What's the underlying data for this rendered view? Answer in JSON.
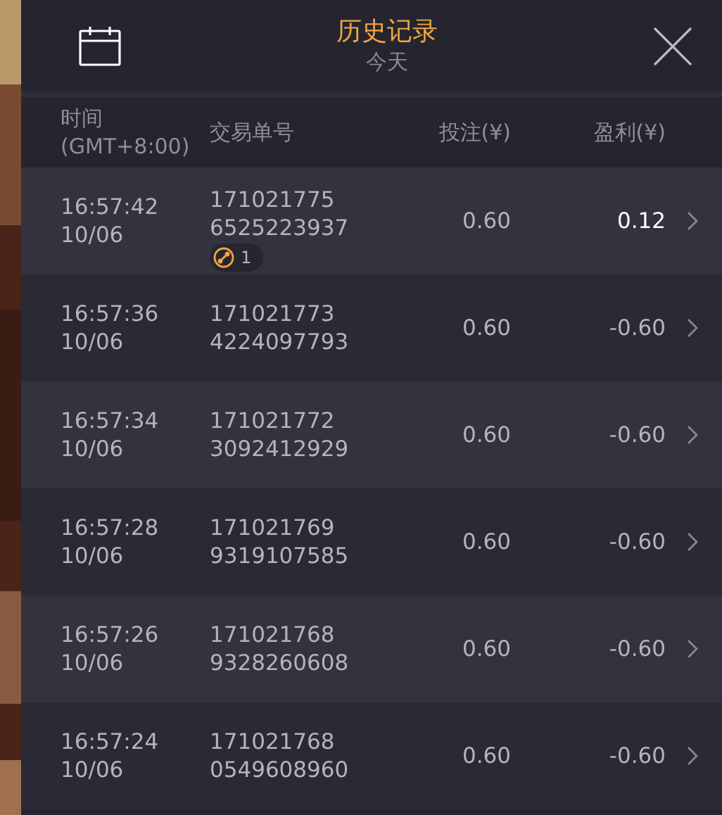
{
  "header": {
    "title": "历史记录",
    "subtitle": "今天"
  },
  "columns": [
    {
      "label": "时间",
      "sublabel": "(GMT+8:00)"
    },
    {
      "label": "交易单号"
    },
    {
      "label": "投注(¥)"
    },
    {
      "label": "盈利(¥)"
    }
  ],
  "rows": [
    {
      "time": "16:57:42",
      "date": "10/06",
      "order_line_1": "171021775",
      "order_line_2": "6525223937",
      "stake": "0.60",
      "profit": "0.12",
      "positive": true,
      "badge": "1"
    },
    {
      "time": "16:57:36",
      "date": "10/06",
      "order_line_1": "171021773",
      "order_line_2": "4224097793",
      "stake": "0.60",
      "profit": "-0.60",
      "positive": false
    },
    {
      "time": "16:57:34",
      "date": "10/06",
      "order_line_1": "171021772",
      "order_line_2": "3092412929",
      "stake": "0.60",
      "profit": "-0.60",
      "positive": false
    },
    {
      "time": "16:57:28",
      "date": "10/06",
      "order_line_1": "171021769",
      "order_line_2": "9319107585",
      "stake": "0.60",
      "profit": "-0.60",
      "positive": false
    },
    {
      "time": "16:57:26",
      "date": "10/06",
      "order_line_1": "171021768",
      "order_line_2": "9328260608",
      "stake": "0.60",
      "profit": "-0.60",
      "positive": false
    },
    {
      "time": "16:57:24",
      "date": "10/06",
      "order_line_1": "171021768",
      "order_line_2": "0549608960",
      "stake": "0.60",
      "profit": "-0.60",
      "positive": false
    }
  ]
}
